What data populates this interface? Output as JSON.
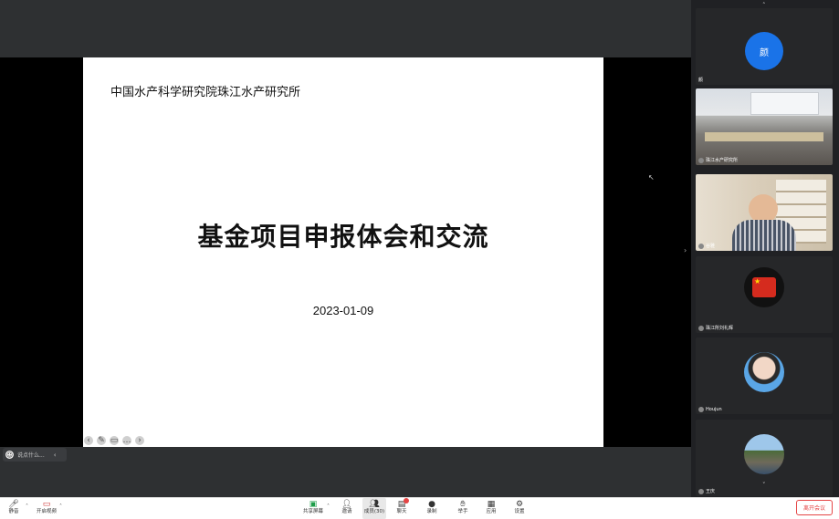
{
  "slide": {
    "org": "中国水产科学研究院珠江水产研究所",
    "title": "基金项目申报体会和交流",
    "date": "2023-01-09"
  },
  "chat": {
    "placeholder": "说点什么..."
  },
  "participants": [
    {
      "name": "颜",
      "avatar_text": "颜"
    },
    {
      "name": "珠江水产研究所"
    },
    {
      "name": "谷雅"
    },
    {
      "name": "珠江所刘礼辉"
    },
    {
      "name": "Houjun"
    },
    {
      "name": "王庆"
    }
  ],
  "toolbar": {
    "mute": "静音",
    "video": "开启视频",
    "share": "共享屏幕",
    "invite": "邀请",
    "members": "成员(30)",
    "chat": "聊天",
    "record": "录制",
    "raise_hand": "举手",
    "apps": "应用",
    "settings": "设置",
    "leave": "离开会议"
  }
}
